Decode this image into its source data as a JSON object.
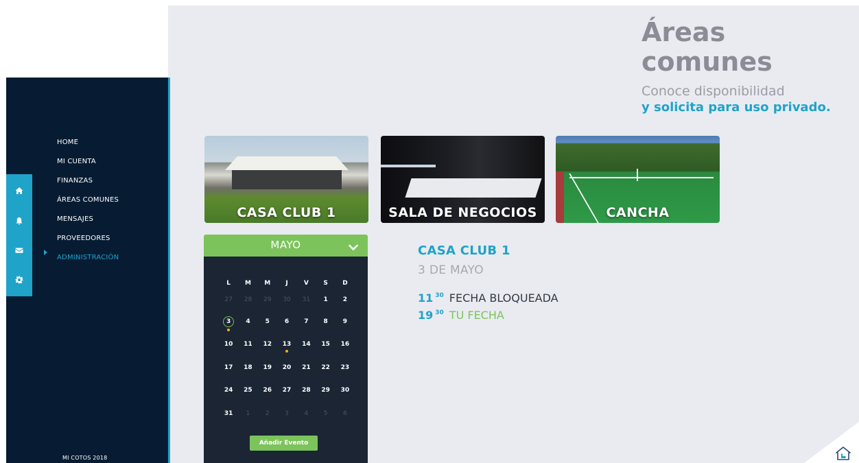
{
  "header": {
    "title_line1": "Áreas",
    "title_line2": "comunes",
    "subtitle": "Conoce disponibilidad",
    "subtitle_strong": "y solicita para uso privado."
  },
  "sidebar": {
    "items": [
      {
        "label": "HOME"
      },
      {
        "label": "MI CUENTA"
      },
      {
        "label": "FINANZAS"
      },
      {
        "label": "ÁREAS COMUNES"
      },
      {
        "label": "MENSAJES"
      },
      {
        "label": "PROVEEDORES"
      },
      {
        "label": "ADMINISTRACIÓN",
        "active": true
      }
    ],
    "icons": [
      "home-icon",
      "bell-icon",
      "mail-icon",
      "gear-icon"
    ],
    "footer": "MI COTOS 2018"
  },
  "cards": [
    {
      "label": "CASA CLUB 1"
    },
    {
      "label": "SALA DE NEGOCIOS"
    },
    {
      "label": "CANCHA"
    }
  ],
  "calendar": {
    "month": "MAYO",
    "weekdays": [
      "L",
      "M",
      "M",
      "J",
      "V",
      "S",
      "D"
    ],
    "weeks": [
      [
        "27",
        "28",
        "29",
        "30",
        "31",
        "1",
        "2"
      ],
      [
        "3",
        "4",
        "5",
        "6",
        "7",
        "8",
        "9"
      ],
      [
        "10",
        "11",
        "12",
        "13",
        "14",
        "15",
        "16"
      ],
      [
        "17",
        "18",
        "19",
        "20",
        "21",
        "22",
        "23"
      ],
      [
        "24",
        "25",
        "26",
        "27",
        "28",
        "29",
        "30"
      ],
      [
        "31",
        "1",
        "2",
        "3",
        "4",
        "5",
        "6"
      ]
    ],
    "selected": "3",
    "add_label": "Añadir Evento"
  },
  "detail": {
    "title": "CASA CLUB 1",
    "date": "3 DE MAYO",
    "slots": [
      {
        "hour": "11",
        "minutes": "30",
        "text": "FECHA BLOQUEADA"
      },
      {
        "hour": "19",
        "minutes": "30",
        "text": "TU FECHA"
      }
    ]
  },
  "colors": {
    "accent": "#1fa3c9",
    "green": "#7cc35b",
    "sidebar": "#071c33",
    "event_dot": "#f2b01d"
  }
}
